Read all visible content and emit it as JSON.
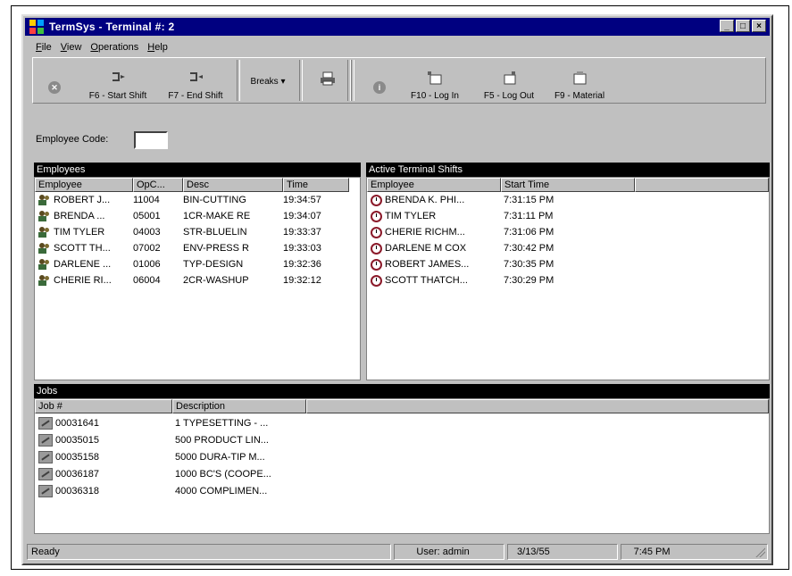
{
  "window": {
    "title": "TermSys - Terminal #: 2"
  },
  "title_buttons": {
    "minimize": "_",
    "maximize": "□",
    "close": "×"
  },
  "menu": [
    "File",
    "View",
    "Operations",
    "Help"
  ],
  "toolbar": {
    "start_shift": "F6 - Start Shift",
    "end_shift": "F7 - End Shift",
    "breaks": "Breaks",
    "log_in": "F10 - Log In",
    "log_out": "F5 - Log Out",
    "material": "F9 - Material"
  },
  "employee_code": {
    "label": "Employee Code:",
    "value": ""
  },
  "employees": {
    "header": "Employees",
    "columns": [
      "Employee",
      "OpC...",
      "Desc",
      "Time"
    ],
    "rows": [
      [
        "ROBERT J...",
        "11004",
        "BIN-CUTTING",
        "19:34:57"
      ],
      [
        "BRENDA ...",
        "05001",
        "1CR-MAKE RE",
        "19:34:07"
      ],
      [
        "TIM TYLER",
        "04003",
        "STR-BLUELIN",
        "19:33:37"
      ],
      [
        "SCOTT TH...",
        "07002",
        "ENV-PRESS R",
        "19:33:03"
      ],
      [
        "DARLENE ...",
        "01006",
        "TYP-DESIGN",
        "19:32:36"
      ],
      [
        "CHERIE RI...",
        "06004",
        "2CR-WASHUP",
        "19:32:12"
      ]
    ]
  },
  "active_shifts": {
    "header": "Active Terminal Shifts",
    "columns": [
      "Employee",
      "Start Time"
    ],
    "rows": [
      [
        "BRENDA K. PHI...",
        "7:31:15 PM"
      ],
      [
        "TIM TYLER",
        "7:31:11 PM"
      ],
      [
        "CHERIE RICHM...",
        "7:31:06 PM"
      ],
      [
        "DARLENE M COX",
        "7:30:42 PM"
      ],
      [
        "ROBERT JAMES...",
        "7:30:35 PM"
      ],
      [
        "SCOTT THATCH...",
        "7:30:29 PM"
      ]
    ]
  },
  "jobs": {
    "header": "Jobs",
    "columns": [
      "Job #",
      "Description"
    ],
    "rows": [
      [
        "00031641",
        "1 TYPESETTING - ..."
      ],
      [
        "00035015",
        "500 PRODUCT LIN..."
      ],
      [
        "00035158",
        "5000 DURA-TIP M..."
      ],
      [
        "00036187",
        "1000 BC'S (COOPE..."
      ],
      [
        "00036318",
        "4000 COMPLIMEN..."
      ]
    ]
  },
  "status": {
    "text": "Ready",
    "user": "User: admin",
    "date": "3/13/55",
    "time": "7:45 PM"
  }
}
